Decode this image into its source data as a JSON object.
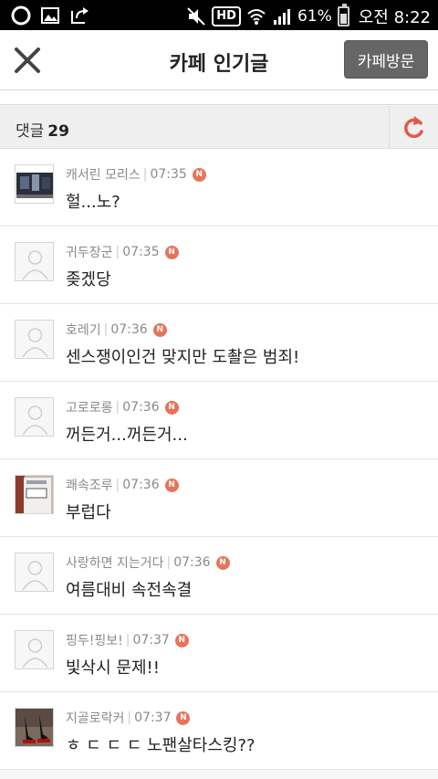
{
  "statusbar": {
    "battery_text": "61%",
    "time": "오전 8:22",
    "hd_label": "HD",
    "icons": [
      "app-icon",
      "gallery-icon",
      "share-icon",
      "mute-icon",
      "hd-voice-icon",
      "wifi-icon",
      "signal-icon",
      "battery-icon"
    ]
  },
  "header": {
    "title": "카페 인기글",
    "visit_label": "카페방문"
  },
  "comments": {
    "label": "댓글",
    "count": "29"
  },
  "colors": {
    "accent": "#e8735a",
    "refresh": "#e05a48"
  },
  "items": [
    {
      "author": "캐서린 모리스",
      "time": "07:35",
      "badge": "N",
      "text": "헐...노?",
      "avatar": "photo-dark"
    },
    {
      "author": "귀두장군",
      "time": "07:35",
      "badge": "N",
      "text": "좆겠당",
      "avatar": "default"
    },
    {
      "author": "호레기",
      "time": "07:36",
      "badge": "N",
      "text": "센스쟁이인건 맞지만 도촬은 범죄!",
      "avatar": "default"
    },
    {
      "author": "고로로롱",
      "time": "07:36",
      "badge": "N",
      "text": "꺼든거...꺼든거...",
      "avatar": "default"
    },
    {
      "author": "쾌속조루",
      "time": "07:36",
      "badge": "N",
      "text": "부럽다",
      "avatar": "photo-bottle"
    },
    {
      "author": "사랑하면 지는거다",
      "time": "07:36",
      "badge": "N",
      "text": "여름대비 속전속결",
      "avatar": "default"
    },
    {
      "author": "핑두!핑보!",
      "time": "07:37",
      "badge": "N",
      "text": "빛삭시 문제!!",
      "avatar": "default"
    },
    {
      "author": "지골로락커",
      "time": "07:37",
      "badge": "N",
      "text": "ㅎ ㄷ ㄷ ㄷ 노팬살타스킹??",
      "avatar": "photo-heels"
    }
  ]
}
